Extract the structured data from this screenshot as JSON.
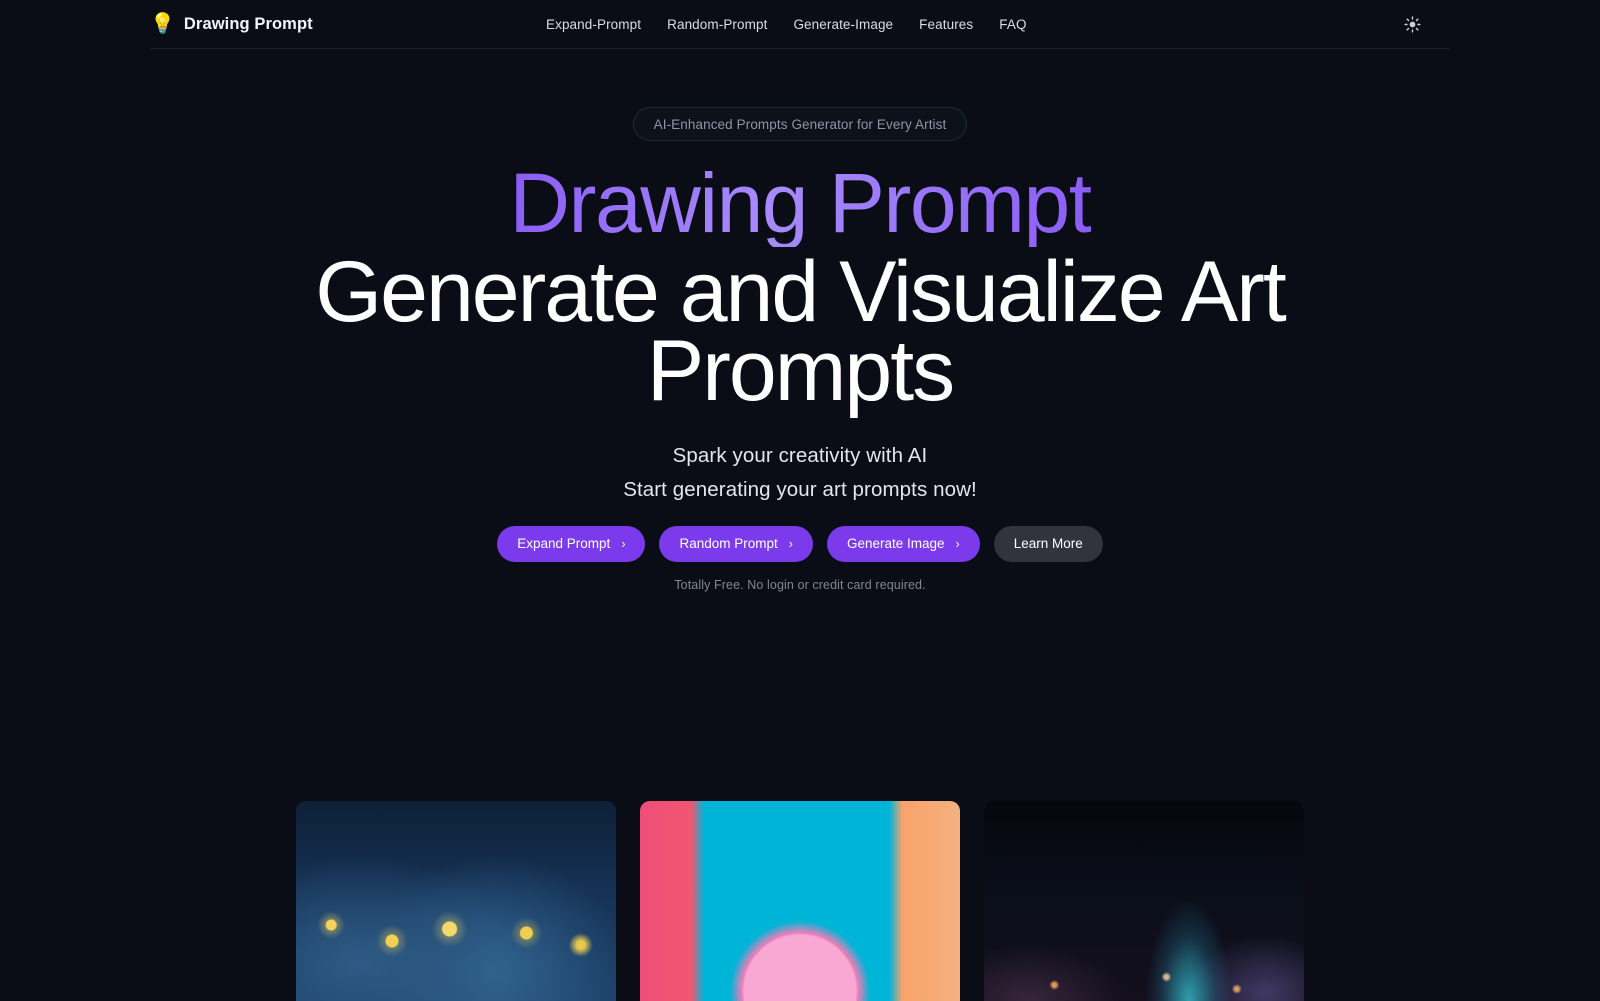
{
  "header": {
    "brand": {
      "logo_icon": "lightbulb-icon",
      "logo_glyph": "💡",
      "name": "Drawing Prompt"
    },
    "nav": [
      {
        "label": "Expand-Prompt"
      },
      {
        "label": "Random-Prompt"
      },
      {
        "label": "Generate-Image"
      },
      {
        "label": "Features"
      },
      {
        "label": "FAQ"
      }
    ],
    "theme_toggle": {
      "icon": "sun-icon",
      "label": "Toggle light mode"
    }
  },
  "hero": {
    "badge": "AI-Enhanced Prompts Generator for Every Artist",
    "title_accent": "Drawing Prompt",
    "title_main": "Generate and Visualize Art Prompts",
    "subtitle_line1": "Spark your creativity with AI",
    "subtitle_line2": "Start generating your art prompts now!",
    "buttons": [
      {
        "label": "Expand Prompt",
        "chevron": "›",
        "style": "primary"
      },
      {
        "label": "Random Prompt",
        "chevron": "›",
        "style": "primary"
      },
      {
        "label": "Generate Image",
        "chevron": "›",
        "style": "primary"
      },
      {
        "label": "Learn More",
        "chevron": "",
        "style": "secondary"
      }
    ],
    "fineprint": "Totally Free. No login or credit card required."
  },
  "gallery": {
    "cards": [
      {
        "name": "starry-night-artwork",
        "style": "art-starry"
      },
      {
        "name": "cyan-dessert-artwork",
        "style": "art-cyan"
      },
      {
        "name": "nebula-space-artwork",
        "style": "art-nebula"
      }
    ]
  },
  "colors": {
    "page_background": "#0a0d16",
    "accent_purple": "#7c3aed",
    "accent_purple_light": "#a78bfa",
    "secondary_button": "#31343c",
    "header_border": "#1b2030",
    "badge_text": "#8d95a6",
    "fineprint_text": "#7f8694"
  }
}
